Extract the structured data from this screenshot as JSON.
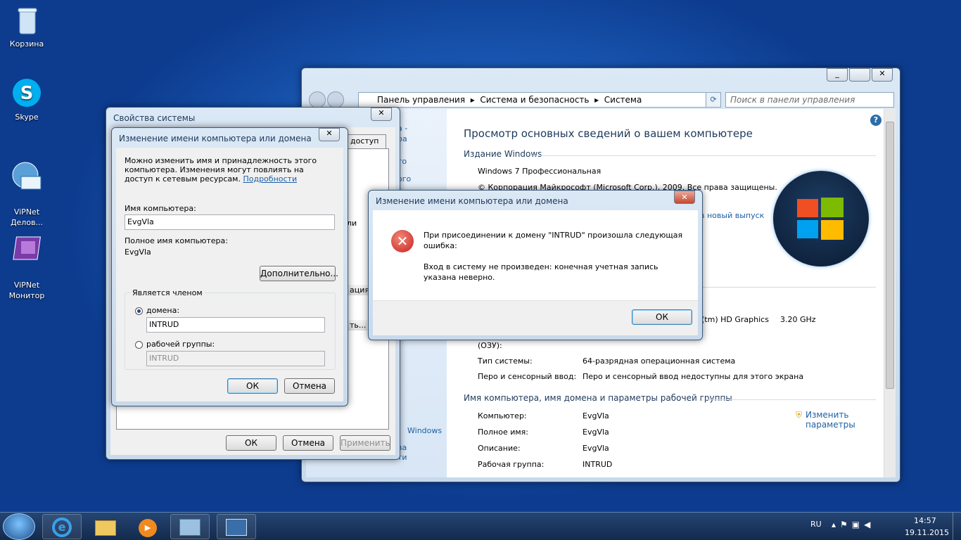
{
  "desktop": {
    "icons": [
      {
        "label": "Корзина"
      },
      {
        "label": "Skype"
      },
      {
        "label": "ViPNet\nДелов..."
      },
      {
        "label": "ViPNet\nМонитор"
      }
    ]
  },
  "controlpanel": {
    "breadcrumb": [
      "Панель управления",
      "Система и безопасность",
      "Система"
    ],
    "search_placeholder": "Поиск в панели управления",
    "left_fragments": [
      "а -",
      "ра",
      "то",
      "ого",
      "Windows",
      "ва",
      "ти"
    ],
    "heading": "Просмотр основных сведений о вашем компьютере",
    "edition_section": "Издание Windows",
    "edition": "Windows 7 Профессиональная",
    "copyright": "© Корпорация Майкрософт (Microsoft Corp.), 2009. Все права защищены.",
    "new_release_link": "в новый выпуск",
    "cpu_fragment": "(tm) HD Graphics",
    "cpu_speed": "3.20 GHz",
    "ram_label": "(ОЗУ):",
    "system_type_label": "Тип системы:",
    "system_type": "64-разрядная операционная система",
    "pen_label": "Перо и сенсорный ввод:",
    "pen_value": "Перо и сенсорный ввод недоступны для этого экрана",
    "name_section": "Имя компьютера, имя домена и параметры рабочей группы",
    "change_link": "Изменить параметры",
    "rows": [
      {
        "k": "Компьютер:",
        "v": "EvgVla"
      },
      {
        "k": "Полное имя:",
        "v": "EvgVla"
      },
      {
        "k": "Описание:",
        "v": "EvgVla"
      },
      {
        "k": "Рабочая группа:",
        "v": "INTRUD"
      }
    ]
  },
  "sysprops": {
    "title": "Свойства системы",
    "tab_fragment": "доступ",
    "frag_li": "ли",
    "frag_ciya": "ация...",
    "frag_t": "ть...",
    "ok": "ОК",
    "cancel": "Отмена",
    "apply": "Применить"
  },
  "rename": {
    "title": "Изменение имени компьютера или домена",
    "intro": "Можно изменить имя и принадлежность этого компьютера. Изменения могут повлиять на доступ к сетевым ресурсам.",
    "details_link": "Подробности",
    "name_label": "Имя компьютера:",
    "name_value": "EvgVla",
    "fullname_label": "Полное имя компьютера:",
    "fullname_value": "EvgVla",
    "more_button": "Дополнительно...",
    "member_group": "Является членом",
    "domain_label": "домена:",
    "domain_value": "INTRUD",
    "workgroup_label": "рабочей группы:",
    "workgroup_value": "INTRUD",
    "ok": "ОК",
    "cancel": "Отмена"
  },
  "error": {
    "title": "Изменение имени компьютера или домена",
    "line1": "При присоединении к домену \"INTRUD\" произошла следующая ошибка:",
    "line2": "Вход в систему не произведен: конечная учетная запись указана неверно.",
    "ok": "ОК"
  },
  "taskbar": {
    "lang": "RU",
    "time": "14:57",
    "date": "19.11.2015"
  }
}
